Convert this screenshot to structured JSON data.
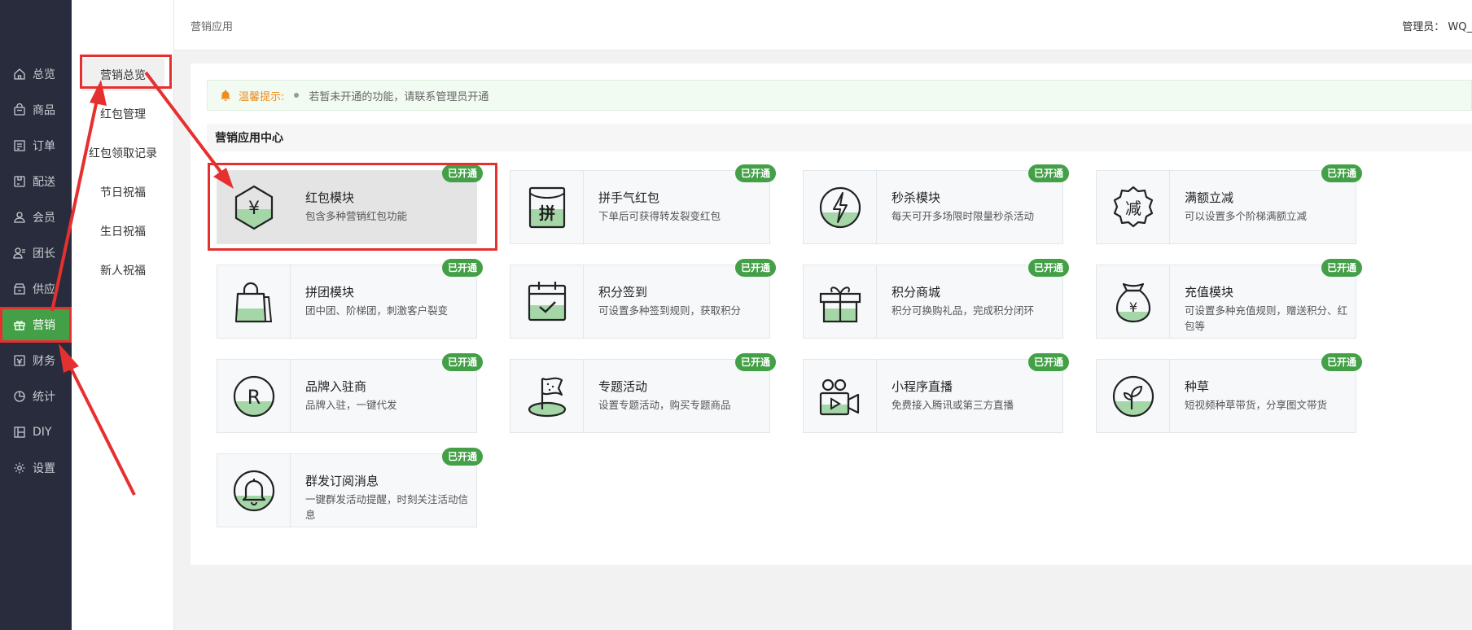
{
  "sidebar": {
    "items": [
      {
        "label": "总览",
        "icon": "home-icon"
      },
      {
        "label": "商品",
        "icon": "shopping-bag-icon"
      },
      {
        "label": "订单",
        "icon": "order-list-icon"
      },
      {
        "label": "配送",
        "icon": "delivery-icon"
      },
      {
        "label": "会员",
        "icon": "user-icon"
      },
      {
        "label": "团长",
        "icon": "leader-icon"
      },
      {
        "label": "供应",
        "icon": "supply-icon"
      },
      {
        "label": "营销",
        "icon": "gift-icon",
        "active": true
      },
      {
        "label": "财务",
        "icon": "wallet-icon"
      },
      {
        "label": "统计",
        "icon": "pie-chart-icon"
      },
      {
        "label": "DIY",
        "icon": "diy-icon"
      },
      {
        "label": "设置",
        "icon": "gear-icon"
      }
    ]
  },
  "subnav": {
    "items": [
      "营销总览",
      "红包管理",
      "红包领取记录",
      "节日祝福",
      "生日祝福",
      "新人祝福"
    ]
  },
  "topbar": {
    "breadcrumb": "营销应用",
    "admin": "管理员： WQ_"
  },
  "notice": {
    "tip": "温馨提示:",
    "message": "若暂未开通的功能，请联系管理员开通"
  },
  "section_title": "营销应用中心",
  "badge_label": "已开通",
  "modules": [
    {
      "title": "红包模块",
      "desc": "包含多种营销红包功能",
      "icon": "red-packet-icon"
    },
    {
      "title": "拼手气红包",
      "desc": "下单后可获得转发裂变红包",
      "icon": "lucky-red-packet-icon"
    },
    {
      "title": "秒杀模块",
      "desc": "每天可开多场限时限量秒杀活动",
      "icon": "flash-sale-icon"
    },
    {
      "title": "满额立减",
      "desc": "可以设置多个阶梯满额立减",
      "icon": "discount-badge-icon"
    },
    {
      "title": "拼团模块",
      "desc": "团中团、阶梯团，刺激客户裂变",
      "icon": "group-buy-bag-icon"
    },
    {
      "title": "积分签到",
      "desc": "可设置多种签到规则，获取积分",
      "icon": "calendar-check-icon"
    },
    {
      "title": "积分商城",
      "desc": "积分可换购礼品，完成积分闭环",
      "icon": "gift-box-icon"
    },
    {
      "title": "充值模块",
      "desc": "可设置多种充值规则，赠送积分、红包等",
      "icon": "money-bag-icon"
    },
    {
      "title": "品牌入驻商",
      "desc": "品牌入驻，一键代发",
      "icon": "registered-brand-icon"
    },
    {
      "title": "专题活动",
      "desc": "设置专题活动，购买专题商品",
      "icon": "flag-icon"
    },
    {
      "title": "小程序直播",
      "desc": "免费接入腾讯或第三方直播",
      "icon": "video-camera-icon"
    },
    {
      "title": "种草",
      "desc": "短视频种草带货，分享图文带货",
      "icon": "sprout-icon"
    },
    {
      "title": "群发订阅消息",
      "desc": "一键群发活动提醒，时刻关注活动信息",
      "icon": "bell-icon"
    }
  ],
  "colors": {
    "sidebar_bg": "#282c3c",
    "accent": "#43a047",
    "highlight": "#e63030",
    "notice_orange": "#f08c1e"
  }
}
